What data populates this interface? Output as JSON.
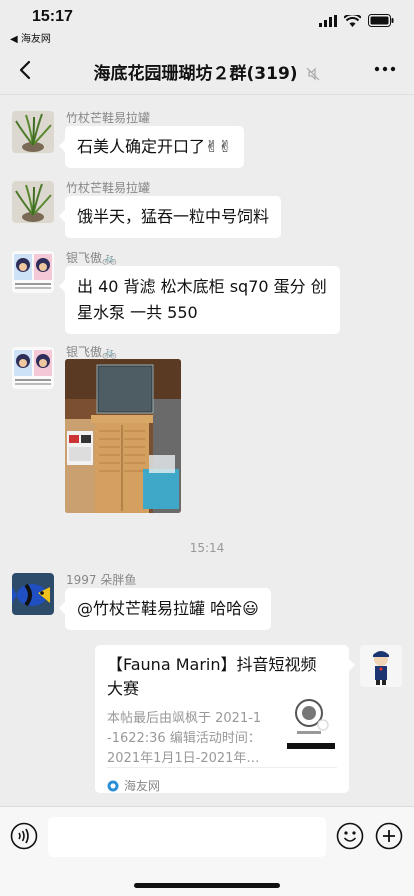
{
  "status": {
    "time": "15:17",
    "back_app": "◀ 海友网"
  },
  "nav": {
    "title": "海底花园珊瑚坊２群(319)"
  },
  "messages": [
    {
      "sender": "竹杖芒鞋易拉罐",
      "text": "石美人确定开口了✌✌"
    },
    {
      "sender": "竹杖芒鞋易拉罐",
      "text": "饿半天，猛吞一粒中号饲料"
    },
    {
      "sender": "银飞傲🚲",
      "text_line1": "出 40 背滤 松木底柜 sq70 蛋分 创",
      "text_line2": "星水泵 一共 550"
    },
    {
      "sender": "银飞傲🚲"
    },
    {
      "sender": "1997 朵胖鱼",
      "text": "@竹杖芒鞋易拉罐 哈哈😃"
    }
  ],
  "timestamp": "15:14",
  "link_card": {
    "title_line1": "【Fauna Marin】抖音短视频",
    "title_line2": "大赛",
    "desc_line1": "本帖最后由飒枫于 2021-1",
    "desc_line2": "-1622:36 编辑活动时间：",
    "desc_line3": "2021年1月1日-2021年…",
    "source": "海友网"
  },
  "colors": {
    "background": "#ededed",
    "bubble": "#ffffff",
    "muted_text": "#888888"
  }
}
